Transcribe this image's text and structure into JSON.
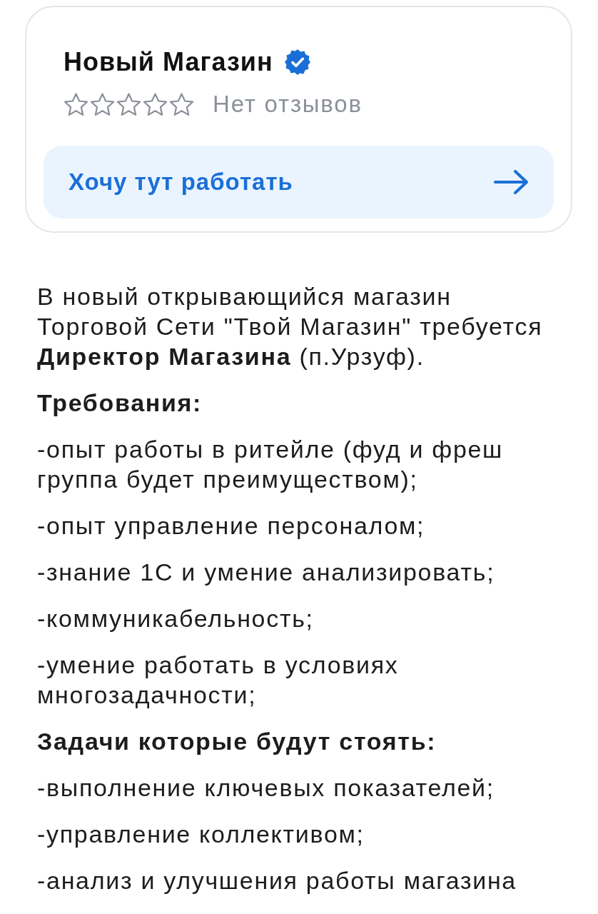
{
  "shop_card": {
    "name": "Новый Магазин",
    "verified": true,
    "rating": {
      "stars": 0
    },
    "reviews_label": "Нет отзывов",
    "action_button": {
      "label": "Хочу тут работать"
    }
  },
  "description": [
    {
      "kind": "paragraph",
      "text": "В новый открывающийся магазин Торговой Сети \"Твой Магазин\" требуется **Директор Магазина** (п.Урзуф)."
    },
    {
      "kind": "heading",
      "text": "Требования:"
    },
    {
      "kind": "paragraph",
      "text": "-опыт работы в ритейле (фуд и фреш группа будет преимуществом);"
    },
    {
      "kind": "paragraph",
      "text": "-опыт управление персоналом;"
    },
    {
      "kind": "paragraph",
      "text": "-знание 1С и умение анализировать;"
    },
    {
      "kind": "paragraph",
      "text": "-коммуникабельность;"
    },
    {
      "kind": "paragraph",
      "text": "-умение работать в условиях многозадачности;"
    },
    {
      "kind": "heading",
      "text": "Задачи которые будут стоять:"
    },
    {
      "kind": "paragraph",
      "text": "-выполнение ключевых показателей;"
    },
    {
      "kind": "paragraph",
      "text": "-управление коллективом;"
    },
    {
      "kind": "paragraph",
      "text": "-анализ и улучшения работы магазина"
    }
  ]
}
